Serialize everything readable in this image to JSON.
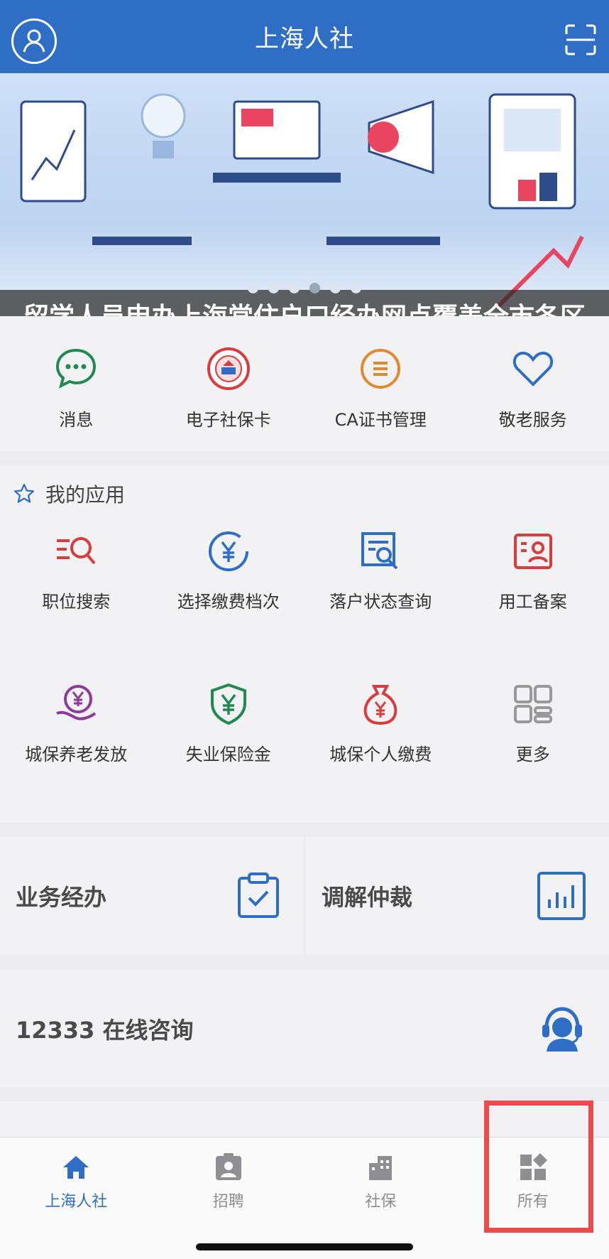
{
  "header": {
    "title": "上海人社",
    "avatar": "person-circle-icon",
    "scan": "scan-icon"
  },
  "banner": {
    "caption": "留学人员申办上海常住户口经办网点覆盖全市各区",
    "active_slide": 4,
    "slide_count": 6
  },
  "quick_links": [
    {
      "label": "消息",
      "icon": "chat-bubble-icon",
      "color": "#1f8a52"
    },
    {
      "label": "电子社保卡",
      "icon": "social-security-card-icon",
      "color": "#d93c3c"
    },
    {
      "label": "CA证书管理",
      "icon": "certificate-list-icon",
      "color": "#e08a2b"
    },
    {
      "label": "敬老服务",
      "icon": "heart-icon",
      "color": "#2f6ec5"
    }
  ],
  "my_apps": {
    "title": "我的应用",
    "icon": "star-outline-icon",
    "items": [
      {
        "label": "职位搜索",
        "icon": "job-search-icon"
      },
      {
        "label": "选择缴费档次",
        "icon": "yuan-circle-icon"
      },
      {
        "label": "落户状态查询",
        "icon": "document-search-icon"
      },
      {
        "label": "用工备案",
        "icon": "employee-badge-icon"
      },
      {
        "label": "城保养老发放",
        "icon": "hand-yuan-icon"
      },
      {
        "label": "失业保险金",
        "icon": "shield-yuan-icon"
      },
      {
        "label": "城保个人缴费",
        "icon": "money-bag-icon"
      },
      {
        "label": "更多",
        "icon": "grid-more-icon"
      }
    ]
  },
  "business": [
    {
      "label": "业务经办",
      "icon": "clipboard-check-icon"
    },
    {
      "label": "调解仲裁",
      "icon": "bar-chart-icon"
    }
  ],
  "consult": {
    "label": "12333 在线咨询",
    "icon": "headset-agent-icon"
  },
  "tabs": [
    {
      "label": "上海人社",
      "icon": "home-icon",
      "active": true
    },
    {
      "label": "招聘",
      "icon": "badge-person-icon",
      "active": false
    },
    {
      "label": "社保",
      "icon": "building-icon",
      "active": false
    },
    {
      "label": "所有",
      "icon": "all-apps-icon",
      "active": false
    }
  ],
  "colors": {
    "brand": "#2f6ec5",
    "active_tab": "#2f6ec5",
    "inactive_tab": "#8e8e93",
    "highlight": "#ee4a4a"
  }
}
